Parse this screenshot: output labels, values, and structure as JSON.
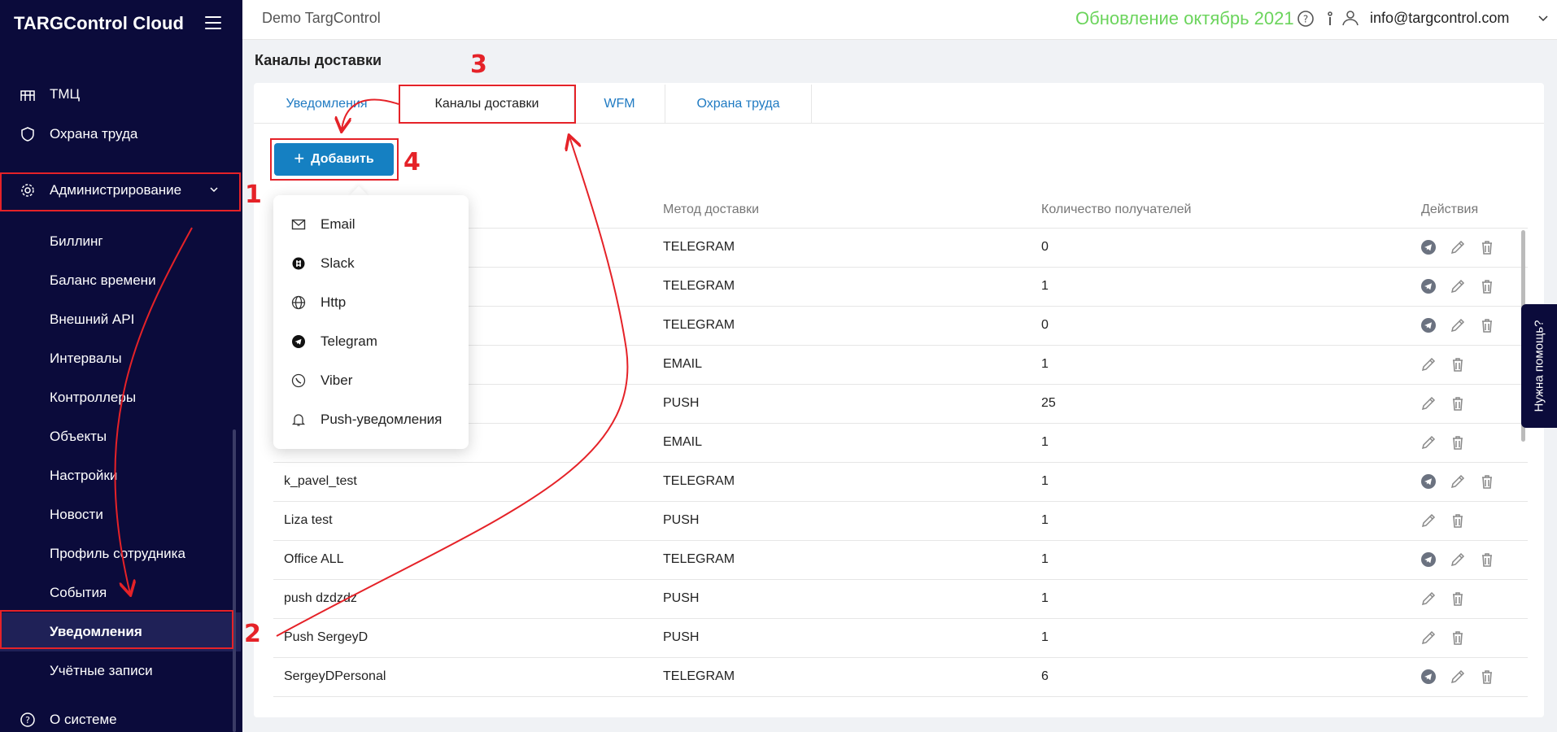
{
  "sidebar": {
    "brand": "TARGControl Cloud",
    "items": [
      {
        "label": "ТМЦ"
      },
      {
        "label": "Охрана труда"
      },
      {
        "label": "Администрирование"
      },
      {
        "label": "Биллинг"
      },
      {
        "label": "Баланс времени"
      },
      {
        "label": "Внешний API"
      },
      {
        "label": "Интервалы"
      },
      {
        "label": "Контроллеры"
      },
      {
        "label": "Объекты"
      },
      {
        "label": "Настройки"
      },
      {
        "label": "Новости"
      },
      {
        "label": "Профиль сотрудника"
      },
      {
        "label": "События"
      },
      {
        "label": "Уведомления"
      },
      {
        "label": "Учётные записи"
      },
      {
        "label": "О системе"
      }
    ]
  },
  "topbar": {
    "company": "Demo TargControl",
    "update": "Обновление октябрь 2021",
    "user_email": "info@targcontrol.com"
  },
  "page": {
    "title": "Каналы доставки",
    "tabs": [
      {
        "label": "Уведомления"
      },
      {
        "label": "Каналы доставки"
      },
      {
        "label": "WFM"
      },
      {
        "label": "Охрана труда"
      }
    ],
    "add_button": "Добавить"
  },
  "dropdown": {
    "items": [
      {
        "label": "Email",
        "icon": "mail-icon"
      },
      {
        "label": "Slack",
        "icon": "slack-icon"
      },
      {
        "label": "Http",
        "icon": "globe-icon"
      },
      {
        "label": "Telegram",
        "icon": "telegram-icon"
      },
      {
        "label": "Viber",
        "icon": "viber-icon"
      },
      {
        "label": "Push-уведомления",
        "icon": "bell-icon"
      }
    ]
  },
  "table": {
    "headers": {
      "method": "Метод доставки",
      "count": "Количество получателей",
      "actions": "Действия"
    },
    "rows": [
      {
        "name": "",
        "method": "TELEGRAM",
        "count": "0",
        "telegram": true
      },
      {
        "name": "",
        "method": "TELEGRAM",
        "count": "1",
        "telegram": true
      },
      {
        "name": "",
        "method": "TELEGRAM",
        "count": "0",
        "telegram": true
      },
      {
        "name": "",
        "method": "EMAIL",
        "count": "1",
        "telegram": false
      },
      {
        "name": "",
        "method": "PUSH",
        "count": "25",
        "telegram": false
      },
      {
        "name": "",
        "method": "EMAIL",
        "count": "1",
        "telegram": false
      },
      {
        "name": "k_pavel_test",
        "method": "TELEGRAM",
        "count": "1",
        "telegram": true
      },
      {
        "name": "Liza test",
        "method": "PUSH",
        "count": "1",
        "telegram": false
      },
      {
        "name": "Office ALL",
        "method": "TELEGRAM",
        "count": "1",
        "telegram": true
      },
      {
        "name": "push dzdzdz",
        "method": "PUSH",
        "count": "1",
        "telegram": false
      },
      {
        "name": "Push SergeyD",
        "method": "PUSH",
        "count": "1",
        "telegram": false
      },
      {
        "name": "SergeyDPersonal",
        "method": "TELEGRAM",
        "count": "6",
        "telegram": true
      }
    ]
  },
  "help": {
    "label": "Нужна помощь?"
  },
  "annotations": {
    "n1": "1",
    "n2": "2",
    "n3": "3",
    "n4": "4"
  },
  "colors": {
    "sidebar_bg": "#0b0b3b",
    "accent": "#1580c2",
    "annotation": "#e52228",
    "update": "#6bd45c"
  }
}
